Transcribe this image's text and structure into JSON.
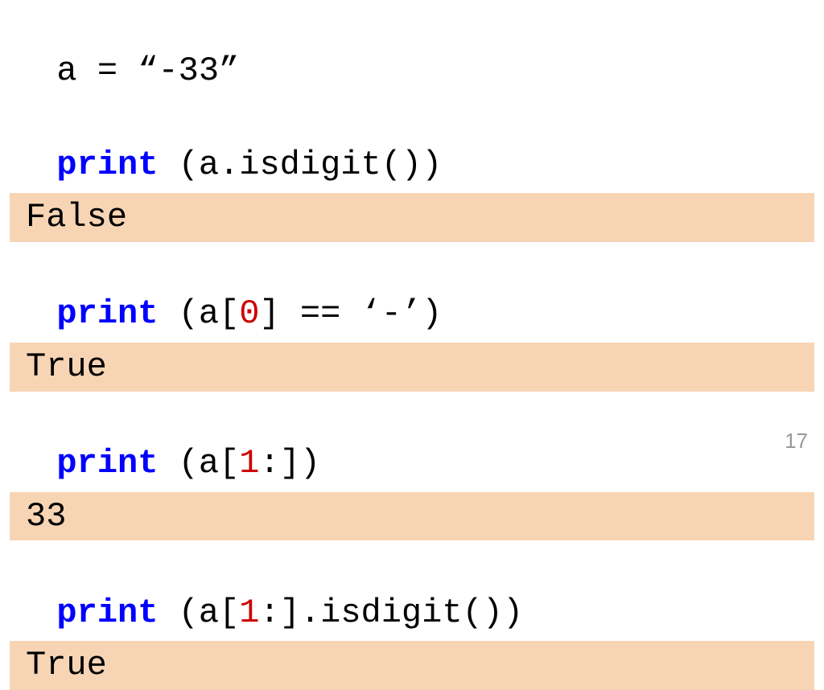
{
  "line1": {
    "text": "a = “-33”"
  },
  "line2": {
    "keyword": "print",
    "rest": " (a.isdigit())"
  },
  "output1": "False",
  "line3": {
    "keyword": "print",
    "part1": " (a[",
    "index": "0",
    "part2": "] == ‘-’)"
  },
  "output2": "True",
  "line4": {
    "keyword": "print",
    "part1": " (a[",
    "index": "1",
    "part2": ":])"
  },
  "output3": "33",
  "line5": {
    "keyword": "print",
    "part1": " (a[",
    "index": "1",
    "part2": ":].isdigit())"
  },
  "output4": "True",
  "page_number": "17"
}
